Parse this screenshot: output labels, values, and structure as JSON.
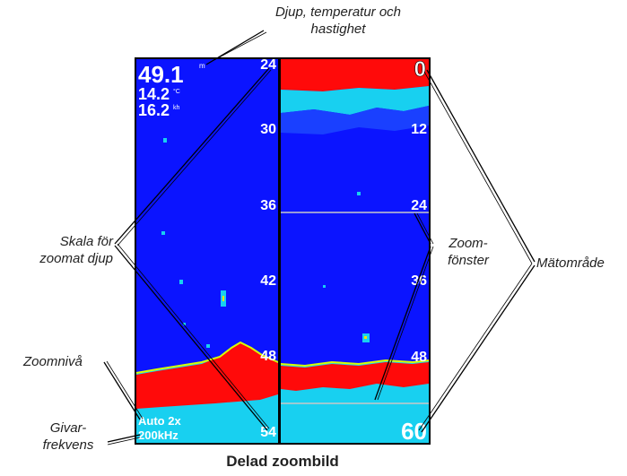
{
  "readouts": {
    "depth": "49.1",
    "temperature": "14.2",
    "speed": "16.2"
  },
  "readout_units": {
    "depth": "m",
    "temperature": "°C",
    "speed": "kh"
  },
  "zoom_scale": [
    "24",
    "30",
    "36",
    "42",
    "48",
    "54"
  ],
  "range_scale": {
    "top": "0",
    "marks": [
      "12",
      "24",
      "36",
      "48"
    ],
    "bottom": "60"
  },
  "status": {
    "zoom_level": "Auto 2x",
    "frequency": "200kHz"
  },
  "callouts": {
    "depth_temp_speed": "Djup, temperatur och\nhastighet",
    "zoomed_depth_scale": "Skala för\nzoomat djup",
    "zoom_window": "Zoom-\nfönster",
    "range": "Mätområde",
    "zoom_level": "Zoomnivå",
    "transducer_frequency": "Givar-\nfrekvens"
  },
  "caption": "Delad zoombild",
  "colors": {
    "water": "#0b14ff",
    "bottom": "#ff0a0a",
    "clutter": "#18d0f0",
    "frame": "#000000"
  }
}
